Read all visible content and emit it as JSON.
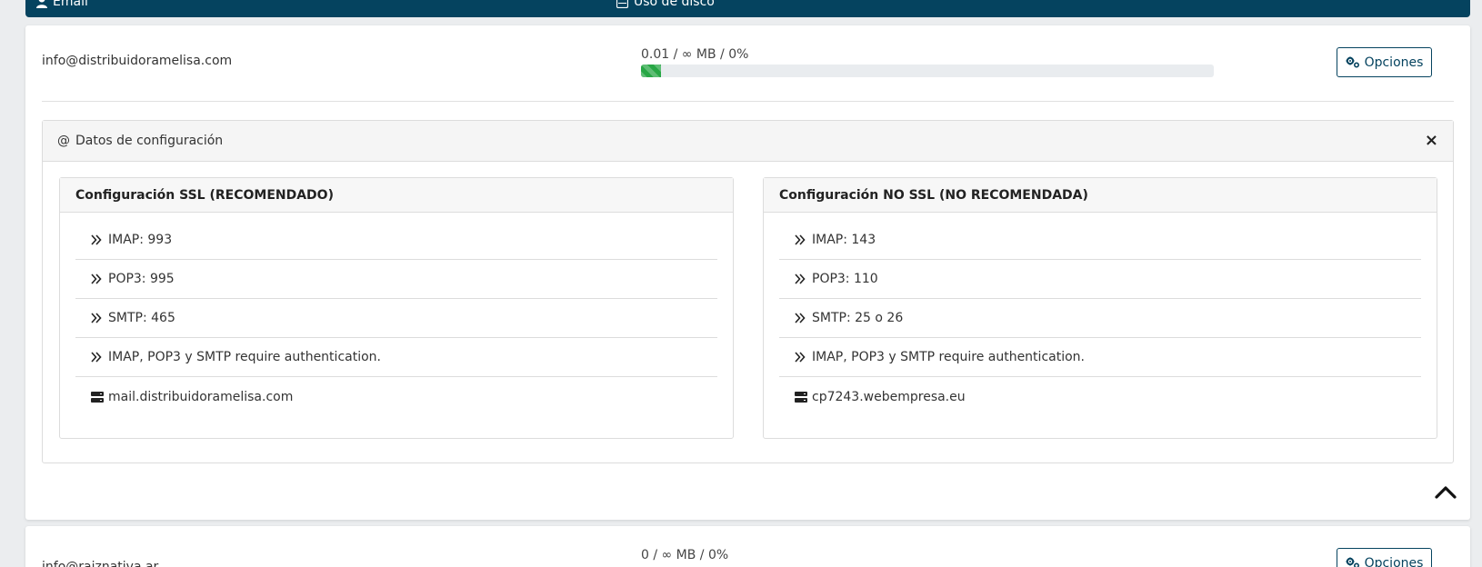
{
  "header": {
    "email_col": "Email",
    "disk_col": "Uso de disco"
  },
  "accounts": [
    {
      "email": "info@distribuidoramelisa.com",
      "usage_text": "0.01 / ∞ MB / 0%",
      "usage_fraction": 0.0,
      "options_label": "Opciones"
    },
    {
      "email": "info@raiznativa.ar",
      "usage_text": "0 / ∞ MB / 0%",
      "options_label": "Opciones"
    }
  ],
  "config": {
    "title": "Datos de configuración",
    "close_symbol": "×",
    "ssl": {
      "title": "Configuración SSL (RECOMENDADO)",
      "items": [
        "IMAP: 993",
        "POP3: 995",
        "SMTP: 465",
        "IMAP, POP3 y SMTP require authentication."
      ],
      "server": "mail.distribuidoramelisa.com"
    },
    "nossl": {
      "title": "Configuración NO SSL (NO RECOMENDADA)",
      "items": [
        "IMAP: 143",
        "POP3: 110",
        "SMTP: 25 o 26",
        "IMAP, POP3 y SMTP require authentication."
      ],
      "server": "cp7243.webempresa.eu"
    }
  },
  "colors": {
    "header_bg": "#05435f",
    "progress_fill": "#28a745",
    "button_border": "#05435f"
  }
}
